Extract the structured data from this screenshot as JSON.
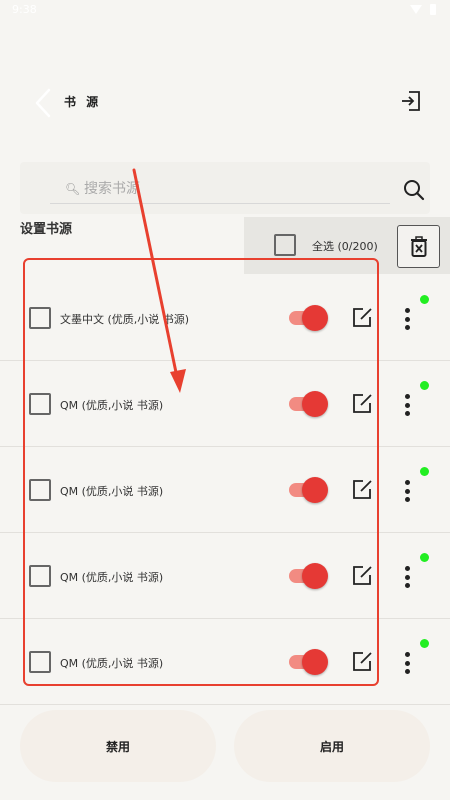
{
  "status_bar": {
    "time": "9:38"
  },
  "header": {
    "title": "书 源"
  },
  "search": {
    "placeholder": "搜索书源",
    "value": ""
  },
  "section_label": "设置书源",
  "select_all": {
    "label": "全选",
    "count": "(0/200)"
  },
  "sources": [
    {
      "name": "文墨中文 (优质,小说 书源)",
      "enabled": true,
      "online": true
    },
    {
      "name": "QM (优质,小说 书源)",
      "enabled": true,
      "online": true
    },
    {
      "name": "QM (优质,小说 书源)",
      "enabled": true,
      "online": true
    },
    {
      "name": "QM (优质,小说 书源)",
      "enabled": true,
      "online": true
    },
    {
      "name": "QM (优质,小说 书源)",
      "enabled": true,
      "online": true
    }
  ],
  "bottom": {
    "disable_label": "禁用",
    "enable_label": "启用"
  },
  "colors": {
    "accent": "#e53935",
    "annotation": "#e8402f",
    "online": "#22ee22"
  },
  "icons": [
    "back-icon",
    "import-icon",
    "search-icon",
    "delete-icon",
    "edit-icon",
    "more-icon"
  ]
}
